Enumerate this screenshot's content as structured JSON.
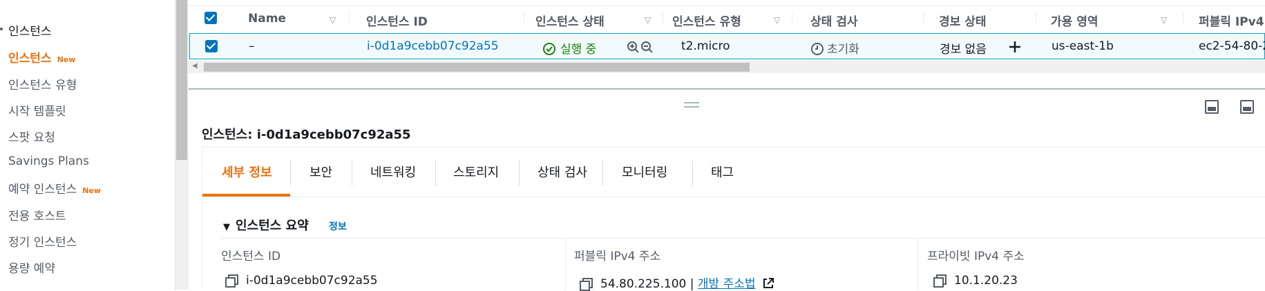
{
  "sidebar": {
    "group_title": "인스턴스",
    "items": [
      {
        "label": "인스턴스",
        "badge": "New",
        "active": true
      },
      {
        "label": "인스턴스 유형"
      },
      {
        "label": "시작 템플릿"
      },
      {
        "label": "스팟 요청"
      },
      {
        "label": "Savings Plans"
      },
      {
        "label": "예약 인스턴스",
        "badge": "New"
      },
      {
        "label": "전용 호스트"
      },
      {
        "label": "정기 인스턴스"
      },
      {
        "label": "용량 예약"
      }
    ]
  },
  "table": {
    "columns": [
      "Name",
      "인스턴스 ID",
      "인스턴스 상태",
      "인스턴스 유형",
      "상태 검사",
      "경보 상태",
      "가용 영역",
      "퍼블릭 IPv4"
    ],
    "row": {
      "name": "–",
      "instance_id": "i-0d1a9cebb07c92a55",
      "state": "실행 중",
      "type": "t2.micro",
      "status_check": "초기화",
      "alarm": "경보 없음",
      "az": "us-east-1b",
      "public_dns": "ec2-54-80-2"
    },
    "horizontal_scroll_fraction": 0.5
  },
  "details": {
    "title": "인스턴스: i-0d1a9cebb07c92a55",
    "tabs": [
      "세부 정보",
      "보안",
      "네트워킹",
      "스토리지",
      "상태 검사",
      "모니터링",
      "태그"
    ],
    "active_tab": "세부 정보",
    "summary": {
      "heading": "인스턴스 요약",
      "info_link": "정보",
      "fields": [
        {
          "label": "인스턴스 ID",
          "value": "i-0d1a9cebb07c92a55"
        },
        {
          "label": "퍼블릭 IPv4 주소",
          "value": "54.80.225.100 |",
          "link": "개방 주소법"
        },
        {
          "label": "프라이빗 IPv4 주소",
          "value": "10.1.20.23"
        }
      ]
    }
  },
  "colors": {
    "accent": "#ec7211",
    "link": "#0073bb",
    "success": "#1d8102"
  }
}
